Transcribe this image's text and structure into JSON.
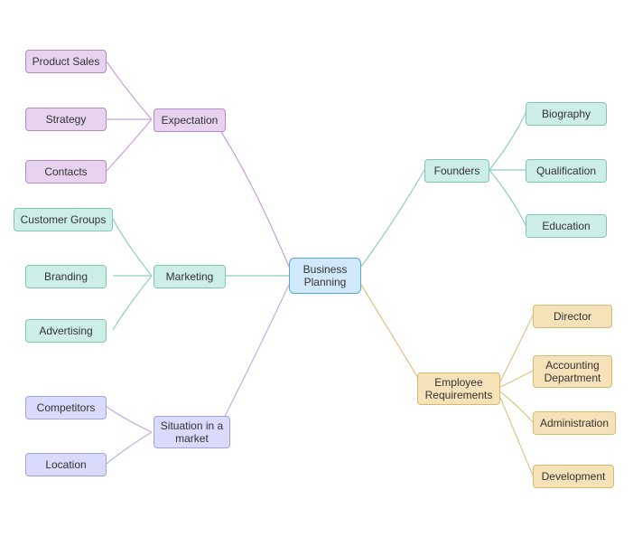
{
  "center": {
    "label": "Business\nPlanning"
  },
  "left": {
    "expectation": {
      "label": "Expectation",
      "children": {
        "productSales": "Product Sales",
        "strategy": "Strategy",
        "contacts": "Contacts"
      }
    },
    "marketing": {
      "label": "Marketing",
      "children": {
        "customerGroups": "Customer Groups",
        "branding": "Branding",
        "advertising": "Advertising"
      }
    },
    "situation": {
      "label": "Situation in a\nmarket",
      "children": {
        "competitors": "Competitors",
        "location": "Location"
      }
    }
  },
  "right": {
    "founders": {
      "label": "Founders",
      "children": {
        "biography": "Biography",
        "qualification": "Qualification",
        "education": "Education"
      }
    },
    "employee": {
      "label": "Employee\nRequirements",
      "children": {
        "director": "Director",
        "accounting": "Accounting\nDepartment",
        "administration": "Administration",
        "development": "Development"
      }
    }
  },
  "colors": {
    "center": {
      "bg": "#cfe9fb",
      "border": "#5aa8d6"
    },
    "purple": {
      "bg": "#e7d3ef",
      "border": "#b58ac6",
      "stroke": "#c9a0d9"
    },
    "teal": {
      "bg": "#cdeee6",
      "border": "#7ec7b6",
      "stroke": "#8bd0bf"
    },
    "lav": {
      "bg": "#dadafb",
      "border": "#a2a2de",
      "stroke": "#b3b3e6"
    },
    "tan": {
      "bg": "#f6e2b8",
      "border": "#d9b96e",
      "stroke": "#e0c384"
    }
  }
}
